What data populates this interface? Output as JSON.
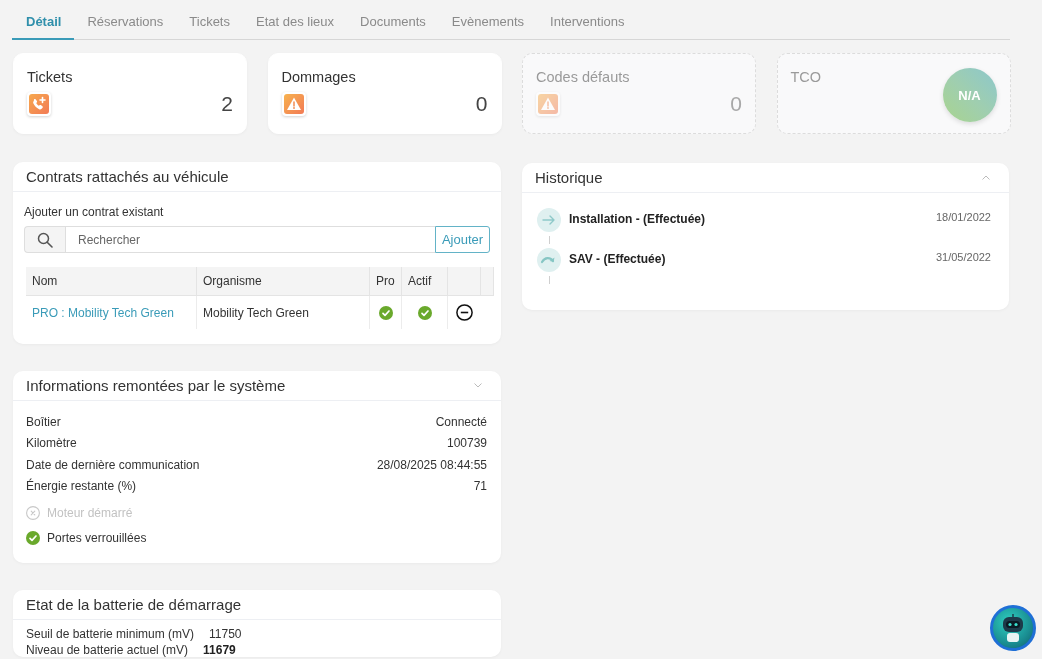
{
  "tabs": [
    {
      "label": "Détail",
      "selected": true
    },
    {
      "label": "Réservations",
      "selected": false
    },
    {
      "label": "Tickets",
      "selected": false
    },
    {
      "label": "Etat des lieux",
      "selected": false
    },
    {
      "label": "Documents",
      "selected": false
    },
    {
      "label": "Evènements",
      "selected": false
    },
    {
      "label": "Interventions",
      "selected": false
    }
  ],
  "stat_cards": [
    {
      "title": "Tickets",
      "kind": "call",
      "value": "2",
      "disabled": false
    },
    {
      "title": "Dommages",
      "kind": "warning",
      "value": "0",
      "disabled": false
    },
    {
      "title": "Codes défauts",
      "kind": "warning",
      "value": "0",
      "disabled": true
    },
    {
      "title": "TCO",
      "kind": "badge",
      "badge": "N/A",
      "disabled": true
    }
  ],
  "contracts": {
    "title": "Contrats rattachés au véhicule",
    "add_label": "Ajouter un contrat existant",
    "search": {
      "placeholder": "Rechercher"
    },
    "add_button": "Ajouter",
    "table": {
      "columns": [
        "Nom",
        "Organisme",
        "Pro",
        "Actif"
      ],
      "rows": [
        {
          "name": "PRO : Mobility Tech Green",
          "organisme": "Mobility Tech Green",
          "pro": true,
          "actif": true
        }
      ]
    }
  },
  "system_info": {
    "title": "Informations remontées par le système",
    "expanded": false,
    "fields": [
      {
        "label": "Boîtier",
        "value": "Connecté"
      },
      {
        "label": "Kilomètre",
        "value": "100739"
      },
      {
        "label": "Date de dernière communication",
        "value": "28/08/2025 08:44:55"
      },
      {
        "label": "Énergie restante (%)",
        "value": "71"
      }
    ],
    "flags": [
      {
        "label": "Moteur démarré",
        "on": false
      },
      {
        "label": "Portes verrouillées",
        "on": true
      }
    ]
  },
  "history": {
    "title": "Historique",
    "expanded": true,
    "events": [
      {
        "kind": "install",
        "title": "Installation - (Effectuée)",
        "date": "18/01/2022"
      },
      {
        "kind": "service",
        "title": "SAV - (Effectuée)",
        "date": "31/05/2022"
      }
    ]
  },
  "battery": {
    "title": "Etat de la batterie de démarrage",
    "rows": [
      {
        "label": "Seuil de batterie minimum (mV)",
        "value": "11750",
        "alert": false
      },
      {
        "label": "Niveau de batterie actuel (mV)",
        "value": "11679",
        "alert": true
      }
    ]
  }
}
